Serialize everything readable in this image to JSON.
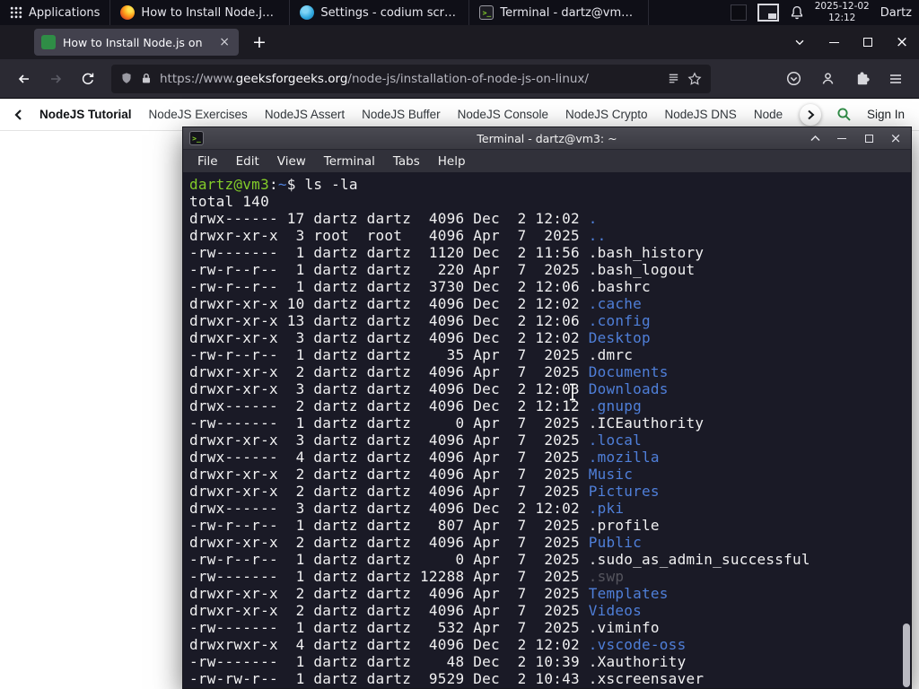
{
  "colors": {
    "gfg_green": "#2f8d46",
    "terminal_dir_blue": "#4f7fd9",
    "terminal_prompt_green": "#83cc29",
    "firefox_dark": "#1c1b22"
  },
  "panel": {
    "applications_label": "Applications",
    "windows": [
      {
        "title": "How to Install Node.js o...",
        "icon": "firefox-icon"
      },
      {
        "title": "Settings - codium script...",
        "icon": "settings-icon"
      },
      {
        "title": "Terminal - dartz@vm3: ~",
        "icon": "terminal-icon"
      }
    ],
    "date": "2025-12-02",
    "time": "12:12",
    "user": "Dartz"
  },
  "browser": {
    "tab_title": "How to Install Node.js on",
    "url_scheme": "https://www.",
    "url_domain": "geeksforgeeks.org",
    "url_path": "/node-js/installation-of-node-js-on-linux/"
  },
  "site_nav": {
    "items": [
      "NodeJS Tutorial",
      "NodeJS Exercises",
      "NodeJS Assert",
      "NodeJS Buffer",
      "NodeJS Console",
      "NodeJS Crypto",
      "NodeJS DNS",
      "Node"
    ],
    "sign_in_label": "Sign In"
  },
  "terminal": {
    "title": "Terminal - dartz@vm3: ~",
    "menu_items": [
      "File",
      "Edit",
      "View",
      "Terminal",
      "Tabs",
      "Help"
    ],
    "prompt": {
      "user_host": "dartz@vm3",
      "separator": ":",
      "cwd": "~",
      "symbol": "$ ",
      "command": "ls -la"
    },
    "total_line": "total 140",
    "listing": [
      {
        "pre": "drwx------ 17 dartz dartz  4096 Dec  2 12:02 ",
        "name": ".",
        "type": "dir"
      },
      {
        "pre": "drwxr-xr-x  3 root  root   4096 Apr  7  2025 ",
        "name": "..",
        "type": "dir"
      },
      {
        "pre": "-rw-------  1 dartz dartz  1120 Dec  2 11:56 ",
        "name": ".bash_history",
        "type": "file"
      },
      {
        "pre": "-rw-r--r--  1 dartz dartz   220 Apr  7  2025 ",
        "name": ".bash_logout",
        "type": "file"
      },
      {
        "pre": "-rw-r--r--  1 dartz dartz  3730 Dec  2 12:06 ",
        "name": ".bashrc",
        "type": "file"
      },
      {
        "pre": "drwxr-xr-x 10 dartz dartz  4096 Dec  2 12:02 ",
        "name": ".cache",
        "type": "dir"
      },
      {
        "pre": "drwxr-xr-x 13 dartz dartz  4096 Dec  2 12:06 ",
        "name": ".config",
        "type": "dir"
      },
      {
        "pre": "drwxr-xr-x  3 dartz dartz  4096 Dec  2 12:02 ",
        "name": "Desktop",
        "type": "dir"
      },
      {
        "pre": "-rw-r--r--  1 dartz dartz    35 Apr  7  2025 ",
        "name": ".dmrc",
        "type": "file"
      },
      {
        "pre": "drwxr-xr-x  2 dartz dartz  4096 Apr  7  2025 ",
        "name": "Documents",
        "type": "dir"
      },
      {
        "pre": "drwxr-xr-x  3 dartz dartz  4096 Dec  2 12:03 ",
        "name": "Downloads",
        "type": "dir"
      },
      {
        "pre": "drwx------  2 dartz dartz  4096 Dec  2 12:12 ",
        "name": ".gnupg",
        "type": "dir"
      },
      {
        "pre": "-rw-------  1 dartz dartz     0 Apr  7  2025 ",
        "name": ".ICEauthority",
        "type": "file"
      },
      {
        "pre": "drwxr-xr-x  3 dartz dartz  4096 Apr  7  2025 ",
        "name": ".local",
        "type": "dir"
      },
      {
        "pre": "drwx------  4 dartz dartz  4096 Apr  7  2025 ",
        "name": ".mozilla",
        "type": "dir"
      },
      {
        "pre": "drwxr-xr-x  2 dartz dartz  4096 Apr  7  2025 ",
        "name": "Music",
        "type": "dir"
      },
      {
        "pre": "drwxr-xr-x  2 dartz dartz  4096 Apr  7  2025 ",
        "name": "Pictures",
        "type": "dir"
      },
      {
        "pre": "drwx------  3 dartz dartz  4096 Dec  2 12:02 ",
        "name": ".pki",
        "type": "dir"
      },
      {
        "pre": "-rw-r--r--  1 dartz dartz   807 Apr  7  2025 ",
        "name": ".profile",
        "type": "file"
      },
      {
        "pre": "drwxr-xr-x  2 dartz dartz  4096 Apr  7  2025 ",
        "name": "Public",
        "type": "dir"
      },
      {
        "pre": "-rw-r--r--  1 dartz dartz     0 Apr  7  2025 ",
        "name": ".sudo_as_admin_successful",
        "type": "file"
      },
      {
        "pre": "-rw-------  1 dartz dartz 12288 Apr  7  2025 ",
        "name": ".swp",
        "type": "dim"
      },
      {
        "pre": "drwxr-xr-x  2 dartz dartz  4096 Apr  7  2025 ",
        "name": "Templates",
        "type": "dir"
      },
      {
        "pre": "drwxr-xr-x  2 dartz dartz  4096 Apr  7  2025 ",
        "name": "Videos",
        "type": "dir"
      },
      {
        "pre": "-rw-------  1 dartz dartz   532 Apr  7  2025 ",
        "name": ".viminfo",
        "type": "file"
      },
      {
        "pre": "drwxrwxr-x  4 dartz dartz  4096 Dec  2 12:02 ",
        "name": ".vscode-oss",
        "type": "dir"
      },
      {
        "pre": "-rw-------  1 dartz dartz    48 Dec  2 10:39 ",
        "name": ".Xauthority",
        "type": "file"
      },
      {
        "pre": "-rw-rw-r--  1 dartz dartz  9529 Dec  2 10:43 ",
        "name": ".xscreensaver",
        "type": "file"
      }
    ]
  }
}
